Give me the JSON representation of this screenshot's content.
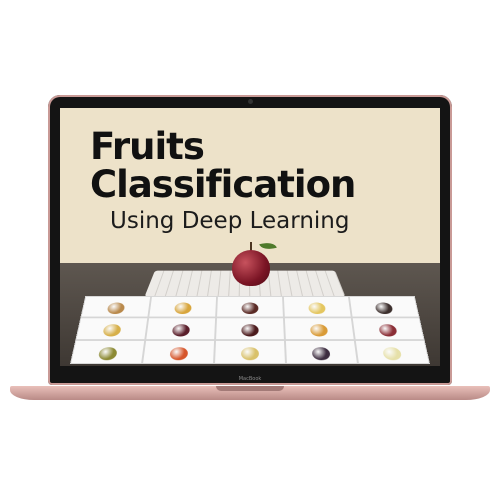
{
  "screen": {
    "title_line1": "Fruits",
    "title_line2": "Classification",
    "subtitle": "Using Deep Learning"
  },
  "laptop": {
    "brand_label": "MacBook"
  },
  "fruit_grid": [
    {
      "icon": "pear-icon",
      "color": "#b9894b"
    },
    {
      "icon": "pear-icon",
      "color": "#d8a53b"
    },
    {
      "icon": "plum-icon",
      "color": "#5a2a25"
    },
    {
      "icon": "pepper-icon",
      "color": "#e4c65f"
    },
    {
      "icon": "fig-icon",
      "color": "#3c2f2d"
    },
    {
      "icon": "quince-icon",
      "color": "#d7b04a"
    },
    {
      "icon": "plum-icon",
      "color": "#5a1e2a"
    },
    {
      "icon": "plum-icon",
      "color": "#4b1a1c"
    },
    {
      "icon": "apricot-icon",
      "color": "#d99b37"
    },
    {
      "icon": "raspberry-icon",
      "color": "#8b2e36"
    },
    {
      "icon": "lime-icon",
      "color": "#8c8a34"
    },
    {
      "icon": "tomato-icon",
      "color": "#d6562b"
    },
    {
      "icon": "citrus-slice-icon",
      "color": "#d9c16a"
    },
    {
      "icon": "fig-icon",
      "color": "#3d2d40"
    },
    {
      "icon": "melon-slice-icon",
      "color": "#e6e0a8"
    }
  ]
}
